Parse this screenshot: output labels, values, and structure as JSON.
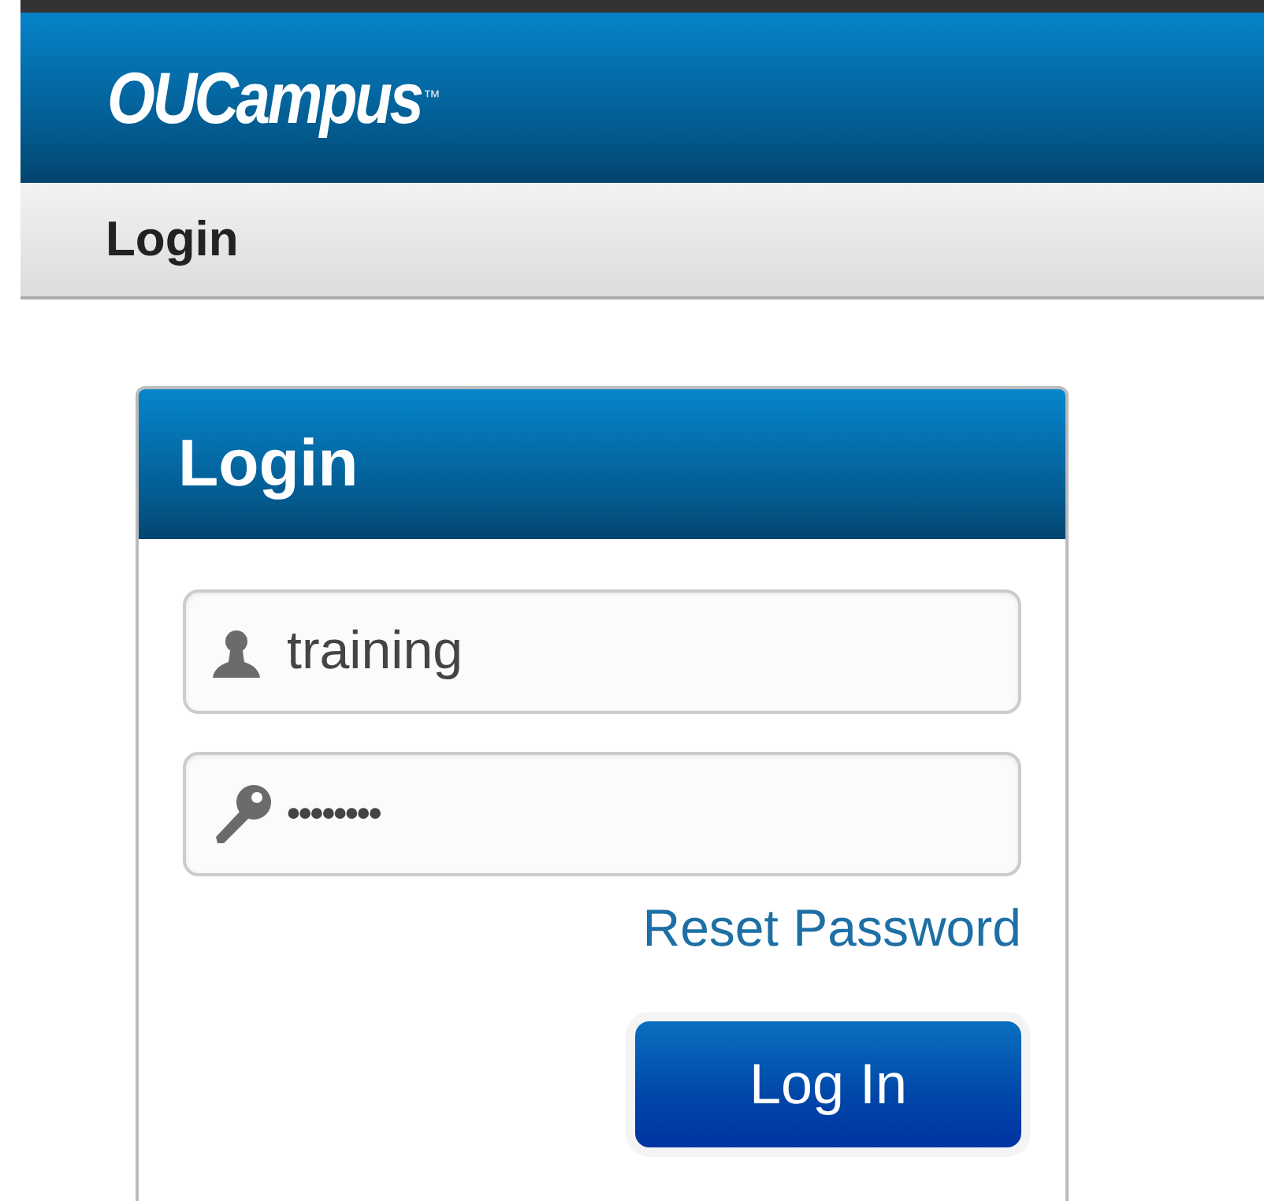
{
  "header": {
    "logo": "OUCampus",
    "trademark": "™"
  },
  "breadcrumb": {
    "title": "Login"
  },
  "login_panel": {
    "title": "Login",
    "username": {
      "value": "training"
    },
    "password": {
      "value": "••••••••"
    },
    "reset_link": "Reset Password",
    "submit": "Log In"
  }
}
